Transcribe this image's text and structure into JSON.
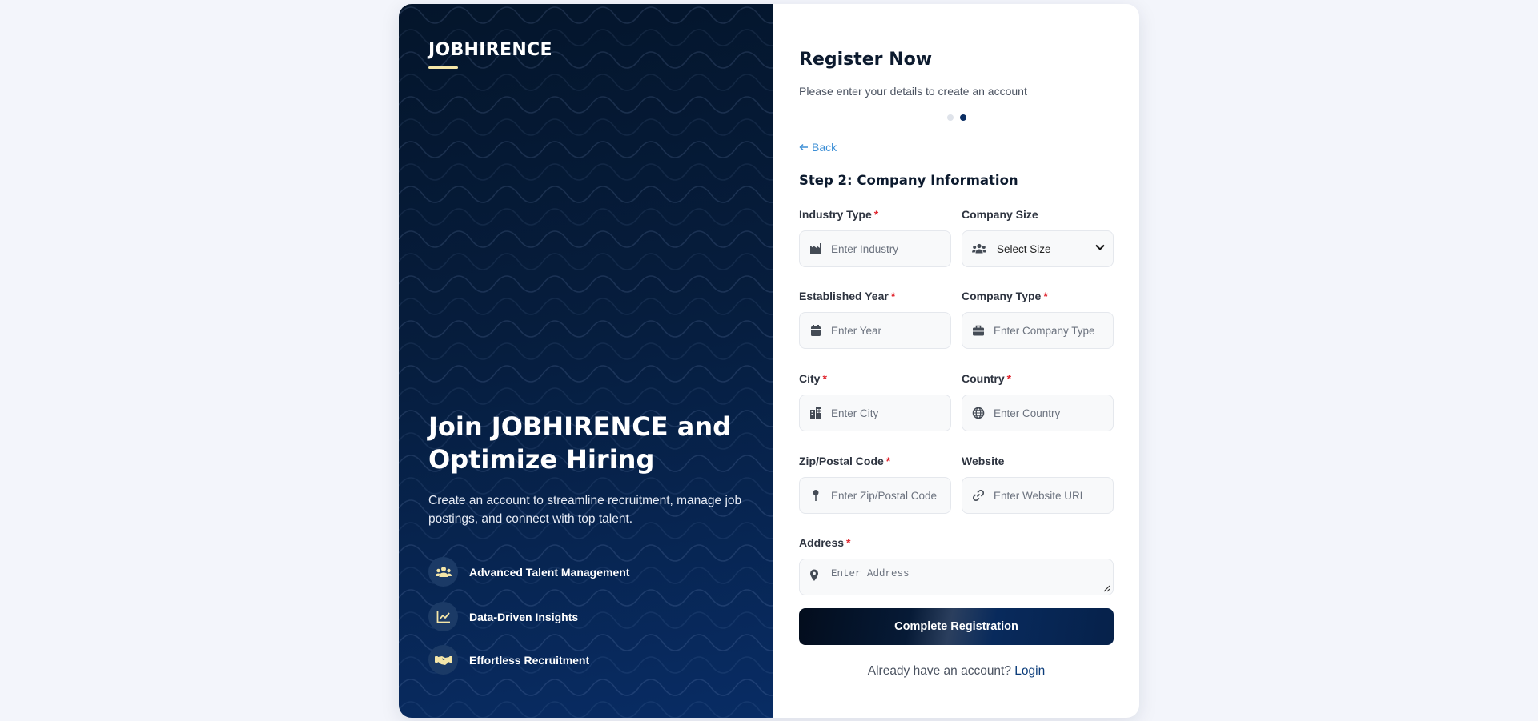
{
  "brand": {
    "name": "JOBHIRENCE",
    "accent": "#f5e6a8"
  },
  "left_panel": {
    "headline": "Join JOBHIRENCE and Optimize Hiring",
    "subtext": "Create an account to streamline recruitment, manage job postings, and connect with top talent.",
    "features": [
      {
        "icon": "users-icon",
        "label": "Advanced Talent Management"
      },
      {
        "icon": "line-chart-icon",
        "label": "Data-Driven Insights"
      },
      {
        "icon": "handshake-icon",
        "label": "Effortless Recruitment"
      }
    ]
  },
  "form": {
    "title": "Register Now",
    "subtitle": "Please enter your details to create an account",
    "steps": {
      "total": 2,
      "current": 2
    },
    "back_label": "Back",
    "step_title": "Step 2: Company Information",
    "fields": {
      "industry": {
        "label": "Industry Type",
        "required": true,
        "placeholder": "Enter Industry",
        "icon": "industry-icon"
      },
      "company_size": {
        "label": "Company Size",
        "required": false,
        "value": "Select Size",
        "icon": "users-icon"
      },
      "established_year": {
        "label": "Established Year",
        "required": true,
        "placeholder": "Enter Year",
        "icon": "calendar-icon"
      },
      "company_type": {
        "label": "Company Type",
        "required": true,
        "placeholder": "Enter Company Type",
        "icon": "briefcase-icon"
      },
      "city": {
        "label": "City",
        "required": true,
        "placeholder": "Enter City",
        "icon": "city-icon"
      },
      "country": {
        "label": "Country",
        "required": true,
        "placeholder": "Enter Country",
        "icon": "globe-icon"
      },
      "zip": {
        "label": "Zip/Postal Code",
        "required": true,
        "placeholder": "Enter Zip/Postal Code",
        "icon": "map-pin-icon"
      },
      "website": {
        "label": "Website",
        "required": false,
        "placeholder": "Enter Website URL",
        "icon": "link-icon"
      },
      "address": {
        "label": "Address",
        "required": true,
        "placeholder": "Enter Address",
        "icon": "location-icon"
      }
    },
    "submit_label": "Complete Registration",
    "login_prompt": "Already have an account?",
    "login_link": "Login"
  },
  "colors": {
    "primary": "#0b2e63",
    "link": "#3d8fd6",
    "required": "#e0262f"
  }
}
